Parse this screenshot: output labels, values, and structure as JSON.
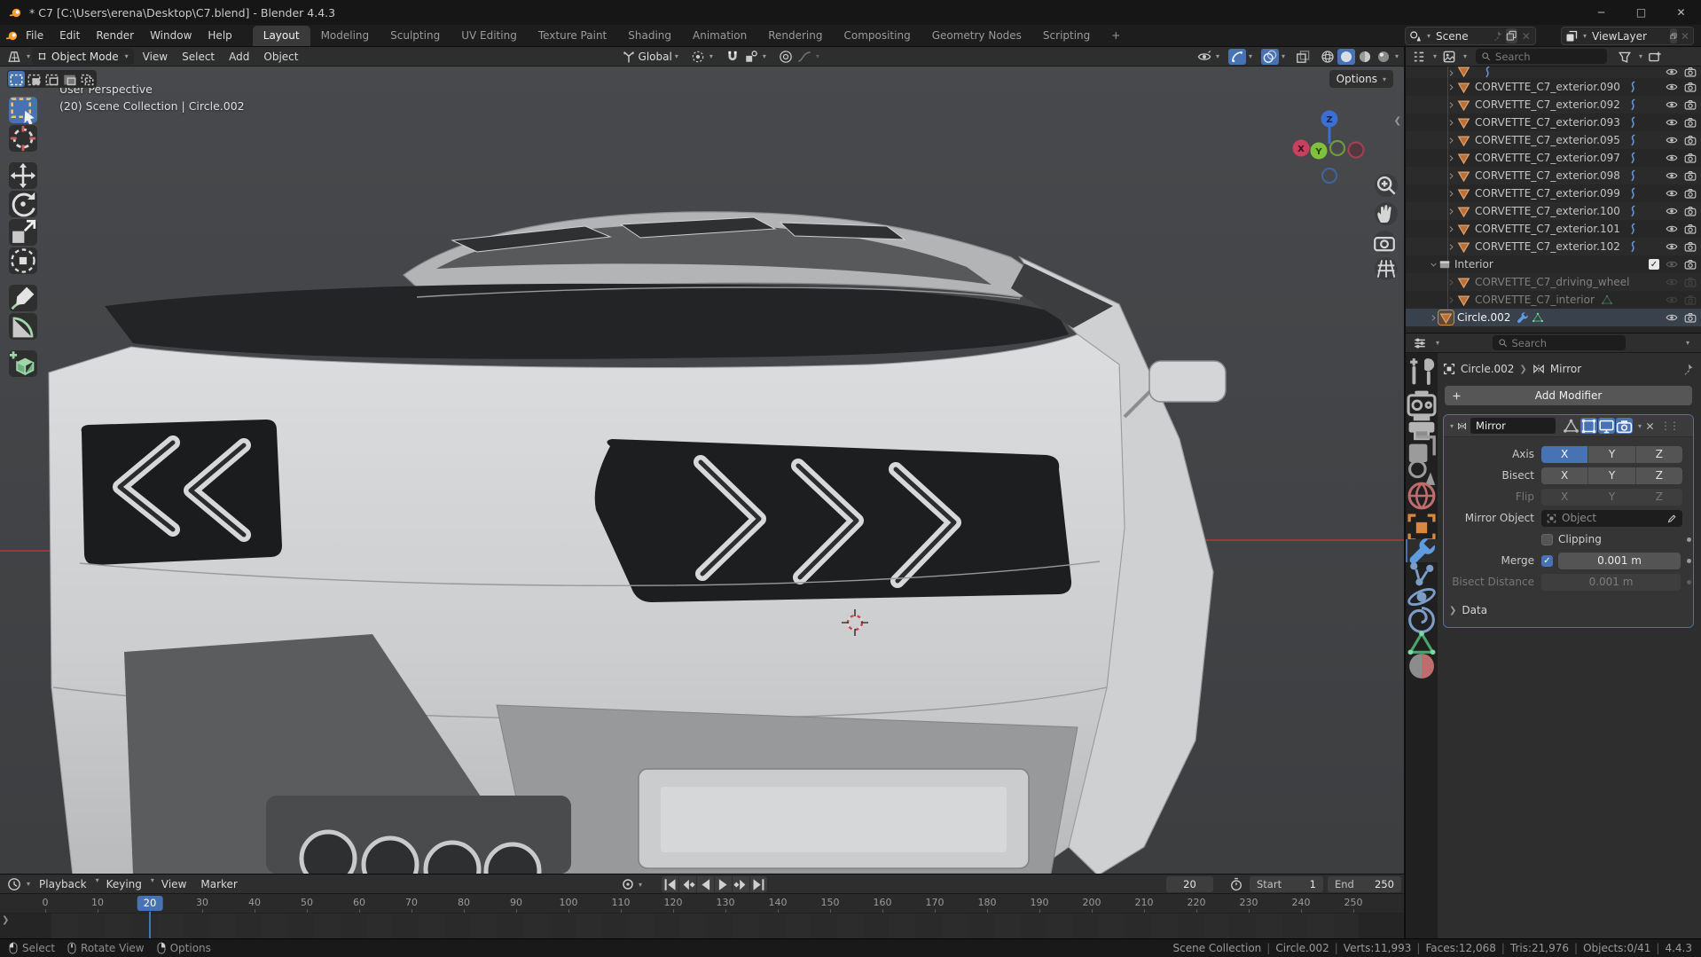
{
  "window": {
    "title": "* C7 [C:\\Users\\erena\\Desktop\\C7.blend] - Blender 4.4.3"
  },
  "topbar": {
    "menus": [
      "File",
      "Edit",
      "Render",
      "Window",
      "Help"
    ],
    "tabs": [
      {
        "label": "Layout",
        "active": true
      },
      {
        "label": "Modeling"
      },
      {
        "label": "Sculpting"
      },
      {
        "label": "UV Editing"
      },
      {
        "label": "Texture Paint"
      },
      {
        "label": "Shading"
      },
      {
        "label": "Animation"
      },
      {
        "label": "Rendering"
      },
      {
        "label": "Compositing"
      },
      {
        "label": "Geometry Nodes"
      },
      {
        "label": "Scripting"
      },
      {
        "label": "+",
        "add": true
      }
    ],
    "scene": {
      "label": "Scene"
    },
    "view_layer": {
      "label": "ViewLayer"
    }
  },
  "viewport": {
    "header": {
      "mode": "Object Mode",
      "menus": [
        "View",
        "Select",
        "Add",
        "Object"
      ],
      "orientation": "Global"
    },
    "options_label": "Options",
    "overlay": {
      "line1": "User Perspective",
      "line2": "(20) Scene Collection | Circle.002"
    },
    "gizmo": {
      "x": "X",
      "y": "Y",
      "z": "Z"
    },
    "select_modes": [
      {
        "name": "select-mode-new",
        "active": true
      },
      {
        "name": "select-mode-extend"
      },
      {
        "name": "select-mode-subtract"
      },
      {
        "name": "select-mode-invert"
      },
      {
        "name": "select-mode-intersect"
      }
    ],
    "toolbar": [
      {
        "name": "select-box-tool",
        "active": true
      },
      {
        "name": "cursor-tool"
      },
      {
        "name": "move-tool"
      },
      {
        "name": "rotate-tool"
      },
      {
        "name": "scale-tool"
      },
      {
        "name": "transform-tool"
      },
      {
        "name": "annotate-tool"
      },
      {
        "name": "measure-tool"
      },
      {
        "name": "add-cube-tool"
      }
    ]
  },
  "outliner": {
    "search_placeholder": "Search",
    "rows": [
      {
        "label": "",
        "kind": "mesh",
        "indent": 2,
        "partial": true,
        "hook": true,
        "eye": "on",
        "camera": "on"
      },
      {
        "label": "CORVETTE_C7_exterior.090",
        "kind": "mesh",
        "indent": 2,
        "hook": true,
        "eye": "on",
        "camera": "on"
      },
      {
        "label": "CORVETTE_C7_exterior.092",
        "kind": "mesh",
        "indent": 2,
        "hook": true,
        "eye": "on",
        "camera": "on"
      },
      {
        "label": "CORVETTE_C7_exterior.093",
        "kind": "mesh",
        "indent": 2,
        "hook": true,
        "eye": "on",
        "camera": "on"
      },
      {
        "label": "CORVETTE_C7_exterior.095",
        "kind": "mesh",
        "indent": 2,
        "hook": true,
        "eye": "on",
        "camera": "on"
      },
      {
        "label": "CORVETTE_C7_exterior.097",
        "kind": "mesh",
        "indent": 2,
        "hook": true,
        "eye": "on",
        "camera": "on"
      },
      {
        "label": "CORVETTE_C7_exterior.098",
        "kind": "mesh",
        "indent": 2,
        "hook": true,
        "eye": "on",
        "camera": "on"
      },
      {
        "label": "CORVETTE_C7_exterior.099",
        "kind": "mesh",
        "indent": 2,
        "hook": true,
        "eye": "on",
        "camera": "on"
      },
      {
        "label": "CORVETTE_C7_exterior.100",
        "kind": "mesh",
        "indent": 2,
        "hook": true,
        "eye": "on",
        "camera": "on"
      },
      {
        "label": "CORVETTE_C7_exterior.101",
        "kind": "mesh",
        "indent": 2,
        "hook": true,
        "eye": "on",
        "camera": "on"
      },
      {
        "label": "CORVETTE_C7_exterior.102",
        "kind": "mesh",
        "indent": 2,
        "hook": true,
        "eye": "on",
        "camera": "on"
      },
      {
        "label": "Interior",
        "kind": "collection",
        "indent": 1,
        "expanded": true,
        "checkbox": true,
        "eye": "dim",
        "camera": "on"
      },
      {
        "label": "CORVETTE_C7_driving_wheel",
        "kind": "mesh",
        "indent": 2,
        "dimmed": true,
        "eye": "dim",
        "camera": "dim"
      },
      {
        "label": "CORVETTE_C7_interior",
        "kind": "mesh",
        "indent": 2,
        "dimmed": true,
        "meshdata": true,
        "eye": "dim",
        "camera": "dim"
      },
      {
        "label": "Circle.002",
        "kind": "mesh",
        "indent": 1,
        "selected": true,
        "wrench": true,
        "meshdata": true,
        "eye": "on",
        "camera": "on"
      }
    ]
  },
  "properties": {
    "search_placeholder": "Search",
    "tabs": [
      {
        "name": "tool-icon"
      },
      {
        "name": "render-icon"
      },
      {
        "name": "output-icon"
      },
      {
        "name": "view-layer-icon"
      },
      {
        "name": "scene-icon"
      },
      {
        "name": "world-icon"
      },
      {
        "name": "object-icon"
      },
      {
        "name": "modifiers-icon",
        "active": true
      },
      {
        "name": "particles-icon"
      },
      {
        "name": "physics-icon"
      },
      {
        "name": "constraints-icon"
      },
      {
        "name": "data-icon"
      },
      {
        "name": "material-icon"
      }
    ],
    "breadcrumb": {
      "object": "Circle.002",
      "modifier": "Mirror"
    },
    "add_modifier_label": "Add Modifier",
    "modifier": {
      "name": "Mirror",
      "toggles": [
        {
          "name": "on-cage-toggle",
          "on": false
        },
        {
          "name": "edit-mode-toggle",
          "on": true
        },
        {
          "name": "realtime-toggle",
          "on": true
        },
        {
          "name": "render-toggle",
          "on": true
        }
      ],
      "axis_rows": [
        {
          "label": "Axis",
          "buttons": [
            {
              "label": "X",
              "active": true
            },
            {
              "label": "Y"
            },
            {
              "label": "Z"
            }
          ]
        },
        {
          "label": "Bisect",
          "buttons": [
            {
              "label": "X"
            },
            {
              "label": "Y"
            },
            {
              "label": "Z"
            }
          ]
        },
        {
          "label": "Flip",
          "disabled": true,
          "buttons": [
            {
              "label": "X"
            },
            {
              "label": "Y"
            },
            {
              "label": "Z"
            }
          ]
        }
      ],
      "mirror_object": {
        "label": "Mirror Object",
        "placeholder": "Object"
      },
      "clipping": {
        "label": "Clipping",
        "checked": false
      },
      "merge": {
        "label": "Merge",
        "checked": true,
        "value": "0.001 m"
      },
      "bisect_distance": {
        "label": "Bisect Distance",
        "value": "0.001 m",
        "disabled": true
      },
      "data_section_label": "Data"
    }
  },
  "timeline": {
    "menus": [
      "Playback",
      "Keying",
      "View",
      "Marker"
    ],
    "transport": [
      "jump-start",
      "prev-keyframe",
      "play-reverse",
      "play-forward",
      "next-keyframe",
      "jump-end"
    ],
    "current_frame": "20",
    "start_label": "Start",
    "start_value": "1",
    "end_label": "End",
    "end_value": "250",
    "ticks": [
      0,
      10,
      20,
      30,
      40,
      50,
      60,
      70,
      80,
      90,
      100,
      110,
      120,
      130,
      140,
      150,
      160,
      170,
      180,
      190,
      200,
      210,
      220,
      230,
      240,
      250
    ]
  },
  "statusbar": {
    "hints": [
      {
        "button": "left",
        "label": "Select"
      },
      {
        "button": "middle",
        "label": "Rotate View"
      },
      {
        "button": "right",
        "label": "Options"
      }
    ],
    "stats": [
      "Scene Collection",
      "Circle.002",
      "Verts:11,993",
      "Faces:12,068",
      "Tris:21,976",
      "Objects:0/41",
      "4.4.3"
    ]
  },
  "colors": {
    "accent": "#4772b3",
    "selection_orange": "#e87d0d",
    "axis_x": "#c8405e",
    "axis_y": "#6fae3c",
    "axis_z": "#3b6fd0"
  }
}
